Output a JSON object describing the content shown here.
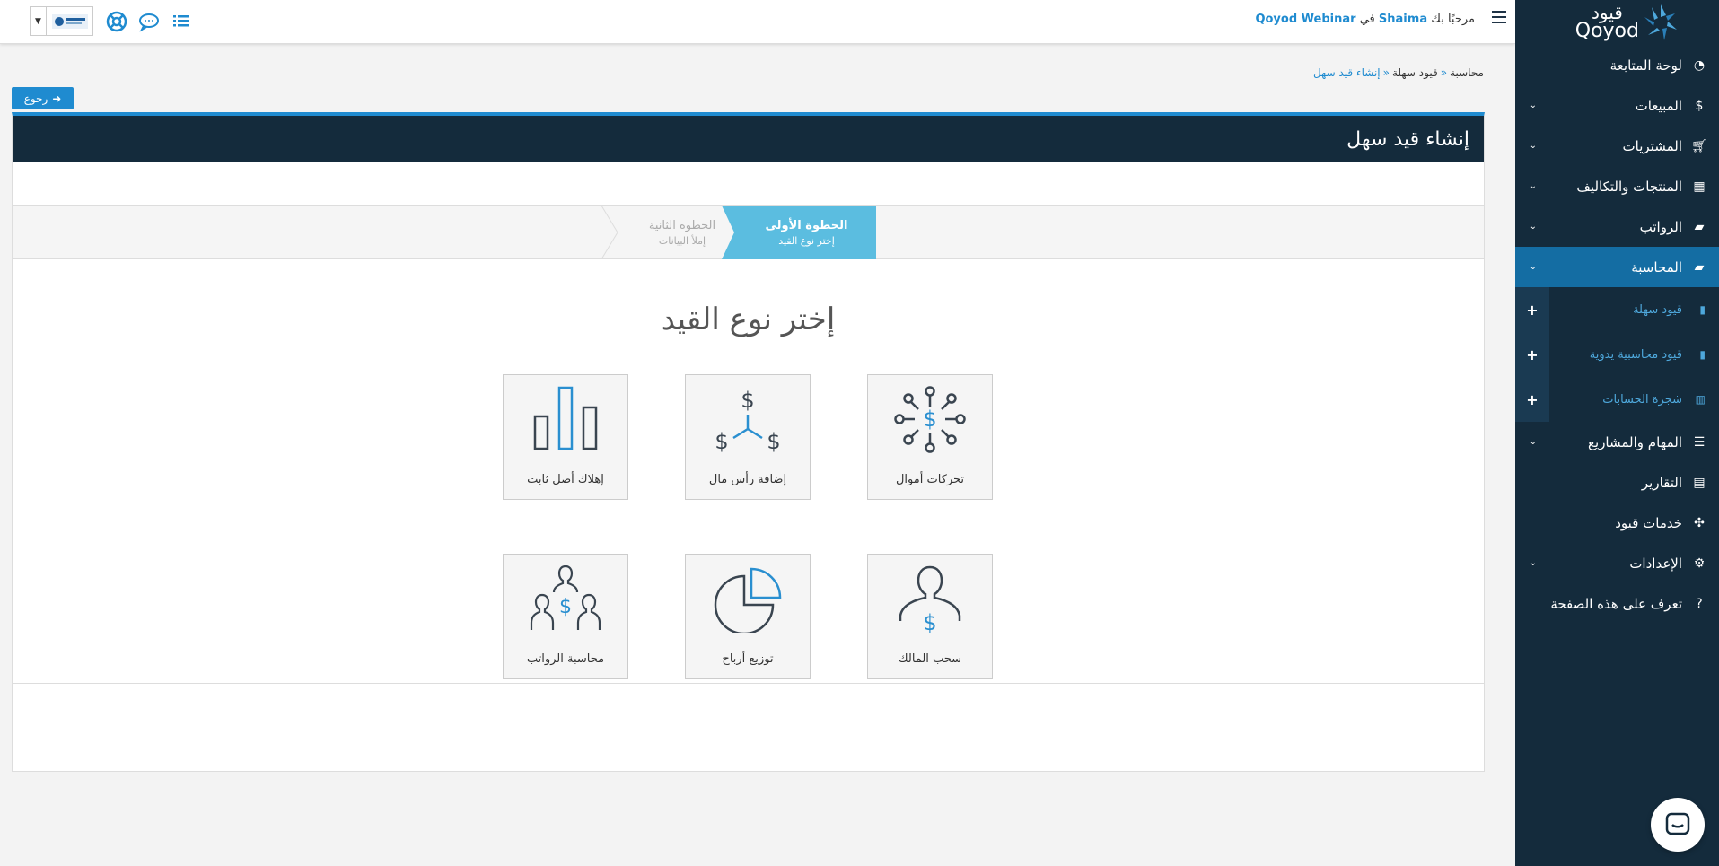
{
  "header": {
    "welcome_prefix": "مرحبًا بك",
    "user": "Shaima",
    "in_word": "في",
    "org": "Qoyod Webinar"
  },
  "brand": {
    "arabic": "قيود",
    "english": "Qoyod"
  },
  "sidebar": {
    "items": [
      {
        "label": "لوحة المتابعة",
        "icon": "dashboard-icon",
        "chevron": false
      },
      {
        "label": "المبيعات",
        "icon": "dollar-icon",
        "chevron": true
      },
      {
        "label": "المشتريات",
        "icon": "cart-icon",
        "chevron": true
      },
      {
        "label": "المنتجات والتكاليف",
        "icon": "grid-icon",
        "chevron": true
      },
      {
        "label": "الرواتب",
        "icon": "folder-icon",
        "chevron": true
      },
      {
        "label": "المحاسبة",
        "icon": "folder-open-icon",
        "chevron": true,
        "active": true
      }
    ],
    "sub_items": [
      {
        "label": "قيود سهلة",
        "icon": "book-icon"
      },
      {
        "label": "قيود محاسبية يدوية",
        "icon": "book-icon"
      },
      {
        "label": "شجرة الحسابات",
        "icon": "chart-icon"
      }
    ],
    "items_after": [
      {
        "label": "المهام والمشاريع",
        "icon": "list-icon",
        "chevron": true
      },
      {
        "label": "التقارير",
        "icon": "file-icon",
        "chevron": false
      },
      {
        "label": "خدمات قيود",
        "icon": "puzzle-icon",
        "chevron": false
      },
      {
        "label": "الإعدادات",
        "icon": "gear-icon",
        "chevron": true
      },
      {
        "label": "تعرف على هذه الصفحة",
        "icon": "question-icon",
        "chevron": false
      }
    ]
  },
  "breadcrumb": {
    "items": [
      "محاسبة",
      "قيود سهلة",
      "إنشاء قيد سهل"
    ]
  },
  "back_button": {
    "label": "رجوع"
  },
  "panel": {
    "title": "إنشاء قيد سهل"
  },
  "wizard": {
    "step1": {
      "title": "الخطوة الأولى",
      "sub": "إختر نوع القيد"
    },
    "step2": {
      "title": "الخطوة الثانية",
      "sub": "إملأ البيانات"
    },
    "choose_title": "إختر نوع القيد",
    "tiles": [
      {
        "label": "تحركات أموال",
        "icon": "money-network-icon"
      },
      {
        "label": "إضافة رأس مال",
        "icon": "capital-icon"
      },
      {
        "label": "إهلاك أصل ثابت",
        "icon": "bar-chart-icon"
      },
      {
        "label": "سحب المالك",
        "icon": "owner-icon"
      },
      {
        "label": "توزيع أرباح",
        "icon": "pie-chart-icon"
      },
      {
        "label": "محاسبة الرواتب",
        "icon": "payroll-icon"
      }
    ]
  },
  "colors": {
    "sidebar": "#142b3c",
    "accent": "#1f8bd0",
    "active_step": "#5bbde0"
  }
}
